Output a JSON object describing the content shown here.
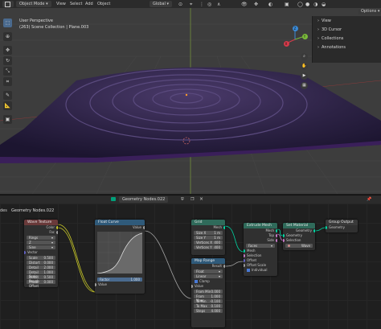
{
  "header": {
    "mode": "Object Mode",
    "menus": [
      "View",
      "Select",
      "Add",
      "Object"
    ],
    "orientation": "Global",
    "options": "Options"
  },
  "viewport": {
    "perspective": "User Perspective",
    "collection": "(263) Scene Collection | Plane.003"
  },
  "gizmo": {
    "z": "Z",
    "y": "Y",
    "x": "X"
  },
  "sidepanel": {
    "items": [
      "View",
      "3D Cursor",
      "Collections",
      "Annotations"
    ]
  },
  "node_editor": {
    "tree_name": "Geometry Nodes.022",
    "left_label": "des"
  },
  "nodes": {
    "scene_time": {
      "title": "Scene Time",
      "out1": "Seconds",
      "out2": "Frame"
    },
    "wave": {
      "title": "Wave Texture",
      "out_color": "Color",
      "out_fac": "Fac",
      "type": "Rings",
      "dir": "Z",
      "profile": "Sine",
      "fields": [
        {
          "label": "Scale",
          "value": "0.500"
        },
        {
          "label": "Distort",
          "value": "0.000"
        },
        {
          "label": "Detail",
          "value": "2.000"
        },
        {
          "label": "Detail Scale",
          "value": "1.000"
        },
        {
          "label": "Detail Rough",
          "value": "0.500"
        },
        {
          "label": "Phase Offset",
          "value": "0.000"
        }
      ],
      "in_vector": "Vector"
    },
    "float_curve": {
      "title": "Float Curve",
      "out": "Value",
      "factor": "Factor",
      "factor_val": "1.000",
      "in_value": "Value"
    },
    "grid": {
      "title": "Grid",
      "out": "Mesh",
      "fields": [
        {
          "label": "Size X",
          "value": "1 m"
        },
        {
          "label": "Size Y",
          "value": "1 m"
        },
        {
          "label": "Vertices X",
          "value": "400"
        },
        {
          "label": "Vertices Y",
          "value": "400"
        }
      ]
    },
    "map_range": {
      "title": "Map Range",
      "out": "Result",
      "dtype": "Float",
      "interp": "Linear",
      "clamp": "Clamp",
      "fields": [
        {
          "label": "Value",
          "value": ""
        },
        {
          "label": "From Min",
          "value": "0.000"
        },
        {
          "label": "From Max",
          "value": "1.000"
        },
        {
          "label": "To Min",
          "value": "-0.100"
        },
        {
          "label": "To Max",
          "value": "0.100"
        },
        {
          "label": "Steps",
          "value": "4.000"
        }
      ]
    },
    "extrude": {
      "title": "Extrude Mesh",
      "outs": [
        "Mesh",
        "Top",
        "Side"
      ],
      "mode": "Faces",
      "ins": [
        "Mesh",
        "Selection",
        "Offset",
        "Offset Scale",
        "Individual"
      ]
    },
    "set_material": {
      "title": "Set Material",
      "out": "Geometry",
      "ins": [
        "Geometry",
        "Selection"
      ],
      "material": "Wave"
    },
    "group_output": {
      "title": "Group Output",
      "in": "Geometry"
    }
  }
}
